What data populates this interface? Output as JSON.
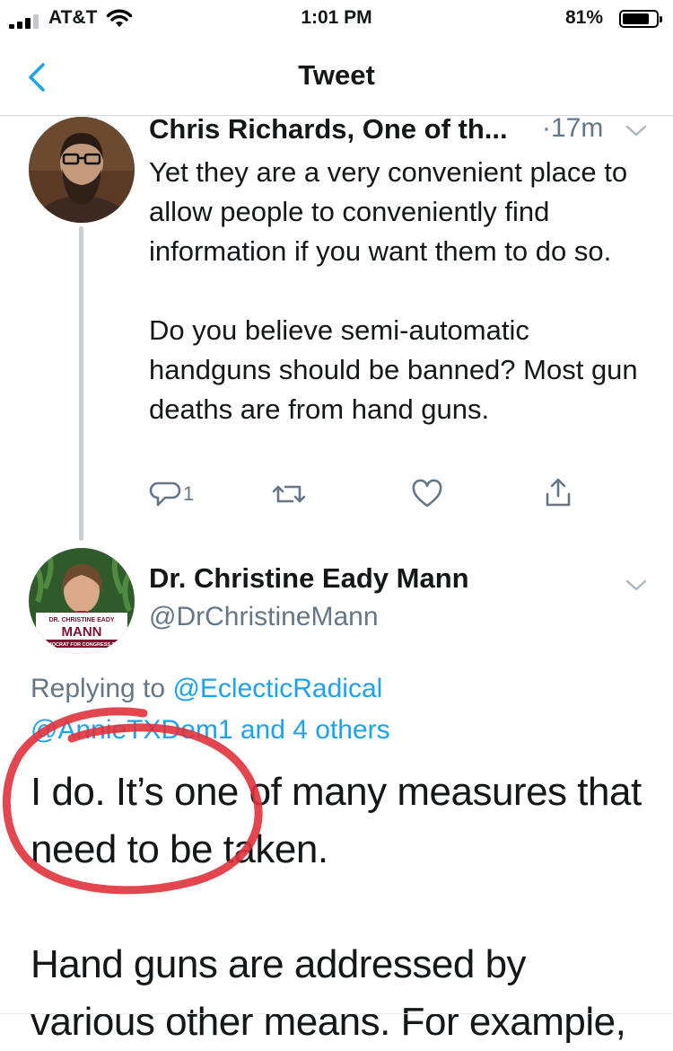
{
  "status_bar": {
    "carrier": "AT&T",
    "time": "1:01 PM",
    "battery_percent": "81%",
    "battery_level": 0.81
  },
  "nav": {
    "title": "Tweet",
    "back_icon": "chevron-left-icon"
  },
  "tweet1": {
    "name": "Chris Richards, One of th...",
    "time": "·17m",
    "body": "Yet they are a very convenient place to allow people to conveniently find information if you want them to do so.\n\nDo you believe semi-automatic handguns should be banned? Most gun deaths are from hand guns.",
    "reply_count": "1",
    "icons": [
      "reply-icon",
      "retweet-icon",
      "like-icon",
      "share-icon"
    ]
  },
  "tweet2": {
    "name": "Dr. Christine Eady Mann",
    "handle": "@DrChristineMann",
    "replying_prefix": "Replying to",
    "replying_link1": "@EclecticRadical",
    "replying_link2": "@AnnieTXDem1 and 4 others",
    "body": "I do. It’s one of many measures that need to be taken.\n\nHand guns are addressed by various other means. For example,",
    "avatar_text_1": "DR. CHRISTINE EADY",
    "avatar_text_2": "MANN",
    "avatar_text_3": "DEMOCRAT FOR CONGRESS TX-2"
  },
  "colors": {
    "link": "#1da1f2",
    "secondary_text": "#657786",
    "annotation": "#e0323c",
    "thread_line": "#c8d0d6"
  }
}
